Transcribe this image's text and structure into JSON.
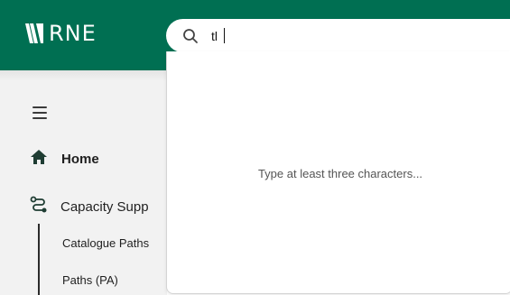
{
  "brand": {
    "logo_text": "RNE",
    "logo_icon": "rne-stripes-icon",
    "color": "#006f52"
  },
  "search": {
    "value": "tl",
    "icon": "search-icon",
    "dropdown_message": "Type at least three characters..."
  },
  "sidebar": {
    "menu_icon": "hamburger-menu-icon",
    "items": [
      {
        "label": "Home",
        "icon": "home-icon"
      },
      {
        "label": "Capacity Supp",
        "icon": "route-icon"
      }
    ],
    "sub_items": [
      {
        "label": "Catalogue Paths"
      },
      {
        "label": "Paths (PA)"
      }
    ]
  }
}
